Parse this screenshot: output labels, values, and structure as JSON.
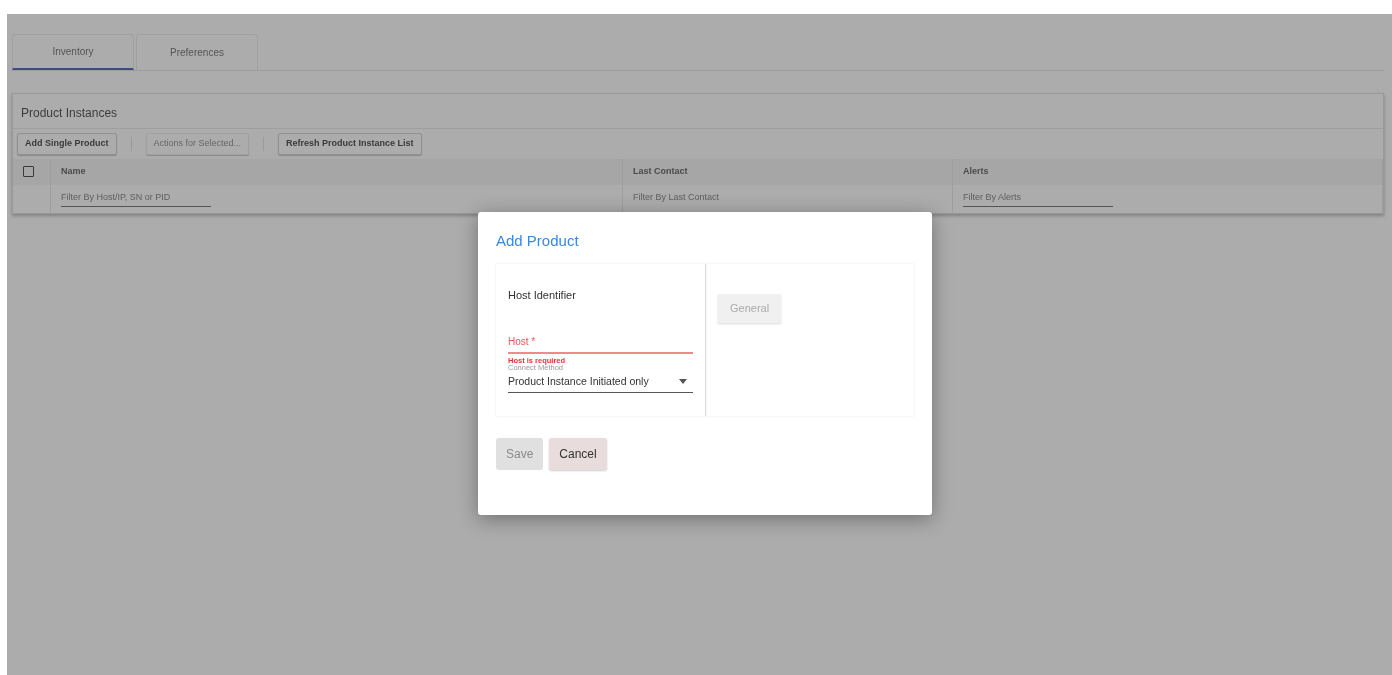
{
  "tabs": [
    {
      "label": "Inventory",
      "selected": true
    },
    {
      "label": "Preferences",
      "selected": false
    }
  ],
  "panel": {
    "title": "Product Instances",
    "toolbar": [
      {
        "label": "Add Single Product",
        "disabled": false
      },
      {
        "label": "Actions for Selected...",
        "disabled": true
      },
      {
        "label": "Refresh Product Instance List",
        "disabled": false
      }
    ],
    "table": {
      "select_all": {
        "checked": false
      },
      "columns": [
        {
          "label": "Name",
          "filter_placeholder": "Filter By Host/IP, SN or PID"
        },
        {
          "label": "Last Contact",
          "filter_placeholder": "Filter By Last Contact"
        },
        {
          "label": "Alerts",
          "filter_placeholder": "Filter By Alerts"
        }
      ]
    }
  },
  "dialog": {
    "title": "Add Product",
    "section_label": "Host Identifier",
    "host_field": {
      "label": "Host *",
      "error": "Host is required",
      "invalid": true
    },
    "connect_method": {
      "label": "Connect Method",
      "value": "Product Instance Initiated only"
    },
    "side_tab": {
      "label": "General",
      "disabled": true
    },
    "buttons": [
      {
        "label": "Save",
        "disabled": true
      },
      {
        "label": "Cancel",
        "disabled": false
      }
    ]
  }
}
